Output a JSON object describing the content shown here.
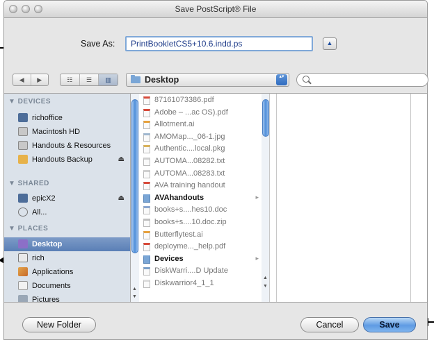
{
  "window": {
    "title": "Save PostScript® File"
  },
  "save_as": {
    "label": "Save As:",
    "value": "PrintBookletCS5+10.6.indd.ps",
    "expand_glyph": "▲"
  },
  "toolbar": {
    "nav_back": "◀",
    "nav_forward": "▶",
    "view_modes": [
      "☷",
      "☰",
      "▥"
    ],
    "location": "Desktop",
    "popup_glyph": "▴▾",
    "search_placeholder": ""
  },
  "sidebar": {
    "devices": {
      "header": "▼ DEVICES",
      "items": [
        {
          "label": "richoffice",
          "icon": "computer-icon"
        },
        {
          "label": "Macintosh HD",
          "icon": "hard-drive-icon"
        },
        {
          "label": "Handouts & Resources",
          "icon": "hard-drive-icon"
        },
        {
          "label": "Handouts Backup",
          "icon": "external-drive-icon",
          "eject": "⏏"
        }
      ]
    },
    "shared": {
      "header": "▼ SHARED",
      "items": [
        {
          "label": "epicX2",
          "icon": "network-computer-icon",
          "eject": "⏏"
        },
        {
          "label": "All...",
          "icon": "network-icon"
        }
      ]
    },
    "places": {
      "header": "▼ PLACES",
      "items": [
        {
          "label": "Desktop",
          "icon": "desktop-icon",
          "selected": true
        },
        {
          "label": "rich",
          "icon": "home-icon"
        },
        {
          "label": "Applications",
          "icon": "applications-icon"
        },
        {
          "label": "Documents",
          "icon": "documents-icon"
        },
        {
          "label": "Pictures",
          "icon": "pictures-icon"
        }
      ]
    }
  },
  "files": [
    {
      "name": "87161073386.pdf",
      "kind": "pdf"
    },
    {
      "name": "Adobe – ...ac OS).pdf",
      "kind": "pdf"
    },
    {
      "name": "Allotment.ai",
      "kind": "ai"
    },
    {
      "name": "AMOMap..._06-1.jpg",
      "kind": "jpg"
    },
    {
      "name": "Authentic....local.pkg",
      "kind": "pkg"
    },
    {
      "name": "AUTOMA...08282.txt",
      "kind": "txt"
    },
    {
      "name": "AUTOMA...08283.txt",
      "kind": "txt"
    },
    {
      "name": "AVA training handout",
      "kind": "pdf"
    },
    {
      "name": "AVAhandouts",
      "kind": "folder",
      "chevron": "▸"
    },
    {
      "name": "books+s....hes10.doc",
      "kind": "doc"
    },
    {
      "name": "books+s....10.doc.zip",
      "kind": "zip"
    },
    {
      "name": "Butterflytest.ai",
      "kind": "ai"
    },
    {
      "name": "deployme..._help.pdf",
      "kind": "pdf"
    },
    {
      "name": "Devices",
      "kind": "folder",
      "chevron": "▸"
    },
    {
      "name": "DiskWarri....D Update",
      "kind": "app"
    },
    {
      "name": "Diskwarrior4_1_1",
      "kind": "file"
    }
  ],
  "buttons": {
    "new_folder": "New Folder",
    "cancel": "Cancel",
    "save": "Save"
  }
}
